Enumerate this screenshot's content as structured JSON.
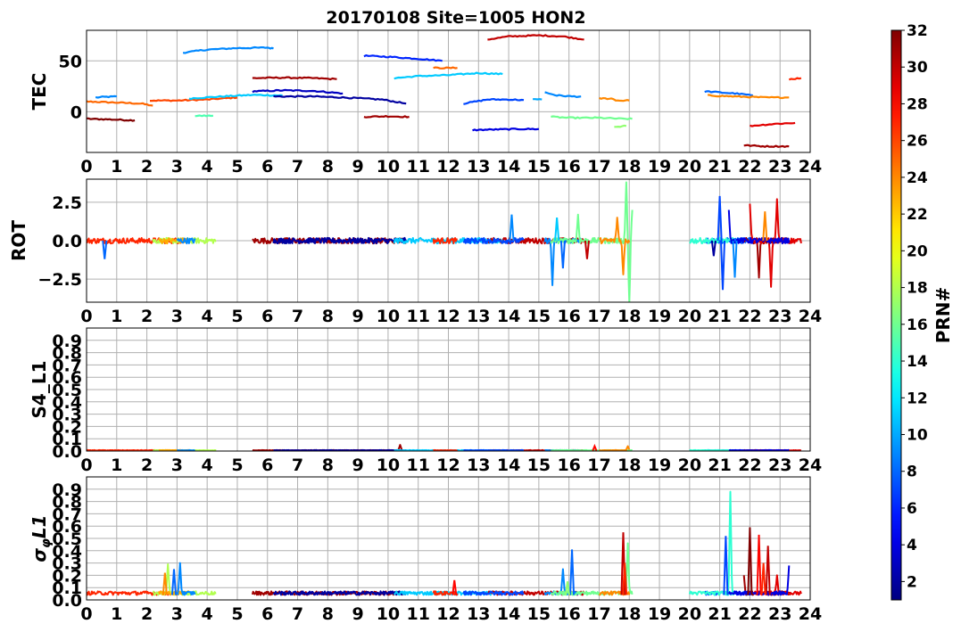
{
  "chart_data": {
    "type": "line",
    "title": "20170108 Site=1005 HON2",
    "x_ticks": [
      "0",
      "1",
      "2",
      "3",
      "4",
      "5",
      "6",
      "7",
      "8",
      "9",
      "10",
      "11",
      "12",
      "13",
      "14",
      "15",
      "16",
      "17",
      "18",
      "19",
      "20",
      "21",
      "22",
      "23",
      "24"
    ],
    "xlim": [
      0,
      24
    ],
    "grid": true,
    "colorbar": {
      "label": "PRN#",
      "range": [
        1,
        32
      ],
      "ticks": [
        "2",
        "4",
        "6",
        "8",
        "10",
        "12",
        "14",
        "16",
        "18",
        "20",
        "22",
        "24",
        "26",
        "28",
        "30",
        "32"
      ],
      "colormap": "jet"
    },
    "panels": [
      {
        "ylabel": "TEC",
        "ylim": [
          -40,
          80
        ],
        "y_ticks": [
          {
            "v": 50,
            "label": "50"
          },
          {
            "v": 0,
            "label": "0"
          }
        ],
        "series": [
          {
            "prn": 9,
            "points": [
              [
                0.3,
                14
              ],
              [
                0.6,
                14.5
              ],
              [
                1.0,
                15
              ]
            ]
          },
          {
            "prn": 25,
            "points": [
              [
                0,
                10
              ],
              [
                1,
                9
              ],
              [
                1.8,
                8
              ],
              [
                2.2,
                6
              ]
            ]
          },
          {
            "prn": 32,
            "points": [
              [
                0,
                -7
              ],
              [
                0.7,
                -7.5
              ],
              [
                1.6,
                -8.5
              ]
            ]
          },
          {
            "prn": 26,
            "points": [
              [
                2.1,
                11
              ],
              [
                3,
                11
              ],
              [
                4,
                12
              ],
              [
                5,
                14
              ]
            ]
          },
          {
            "prn": 15,
            "points": [
              [
                3.6,
                -4
              ],
              [
                4.2,
                -4
              ]
            ]
          },
          {
            "prn": 9,
            "points": [
              [
                3.2,
                58
              ],
              [
                4,
                61
              ],
              [
                5,
                62.5
              ],
              [
                6,
                63
              ],
              [
                6.2,
                62
              ]
            ]
          },
          {
            "prn": 11,
            "points": [
              [
                3.4,
                13
              ],
              [
                4.5,
                15
              ],
              [
                5.5,
                16.5
              ],
              [
                6.5,
                16
              ]
            ]
          },
          {
            "prn": 31,
            "points": [
              [
                5.5,
                33
              ],
              [
                6.5,
                33.5
              ],
              [
                7.5,
                33
              ],
              [
                8.3,
                32
              ]
            ]
          },
          {
            "prn": 3,
            "points": [
              [
                5.5,
                20
              ],
              [
                6.5,
                21
              ],
              [
                7.5,
                20.5
              ],
              [
                8.5,
                18
              ]
            ]
          },
          {
            "prn": 2,
            "points": [
              [
                6.2,
                15
              ],
              [
                7.5,
                15
              ],
              [
                8.5,
                14
              ],
              [
                9.8,
                12
              ],
              [
                10.6,
                8
              ]
            ]
          },
          {
            "prn": 6,
            "points": [
              [
                9.2,
                55
              ],
              [
                10,
                54
              ],
              [
                11,
                52
              ],
              [
                11.8,
                50
              ]
            ]
          },
          {
            "prn": 31,
            "points": [
              [
                9.2,
                -5
              ],
              [
                10,
                -4.5
              ],
              [
                10.7,
                -5
              ]
            ]
          },
          {
            "prn": 25,
            "points": [
              [
                11.5,
                43
              ],
              [
                12.3,
                43
              ]
            ]
          },
          {
            "prn": 11,
            "points": [
              [
                10.2,
                33
              ],
              [
                11,
                35
              ],
              [
                12,
                36
              ],
              [
                13,
                38
              ],
              [
                13.8,
                37
              ]
            ]
          },
          {
            "prn": 30,
            "points": [
              [
                13.3,
                71
              ],
              [
                14,
                74
              ],
              [
                15,
                75
              ],
              [
                15.8,
                74
              ],
              [
                16.5,
                71
              ]
            ]
          },
          {
            "prn": 7,
            "points": [
              [
                12.5,
                8
              ],
              [
                13.3,
                12
              ],
              [
                14,
                12
              ],
              [
                14.5,
                11.5
              ]
            ]
          },
          {
            "prn": 10,
            "points": [
              [
                14.8,
                12
              ],
              [
                15.1,
                12
              ]
            ]
          },
          {
            "prn": 4,
            "points": [
              [
                12.8,
                -18
              ],
              [
                13.5,
                -17.5
              ],
              [
                14.3,
                -17
              ],
              [
                15,
                -17
              ]
            ]
          },
          {
            "prn": 9,
            "points": [
              [
                15.2,
                19
              ],
              [
                15.6,
                16
              ],
              [
                16.1,
                15
              ],
              [
                16.4,
                15
              ]
            ]
          },
          {
            "prn": 16,
            "points": [
              [
                15.4,
                -5
              ],
              [
                16,
                -6
              ],
              [
                17,
                -6
              ],
              [
                17.8,
                -7
              ],
              [
                18.1,
                -7
              ]
            ]
          },
          {
            "prn": 17,
            "points": [
              [
                17.5,
                -15
              ],
              [
                17.9,
                -14
              ]
            ]
          },
          {
            "prn": 24,
            "points": [
              [
                17,
                13
              ],
              [
                17.4,
                13
              ],
              [
                17.6,
                11
              ],
              [
                18,
                11
              ]
            ]
          },
          {
            "prn": 8,
            "points": [
              [
                20.5,
                20
              ],
              [
                21,
                19
              ],
              [
                21.5,
                18
              ],
              [
                22.1,
                16
              ]
            ]
          },
          {
            "prn": 24,
            "points": [
              [
                20.6,
                16
              ],
              [
                21.5,
                15
              ],
              [
                22.5,
                14
              ],
              [
                23.3,
                14
              ]
            ]
          },
          {
            "prn": 27,
            "points": [
              [
                23.3,
                32
              ],
              [
                23.7,
                33
              ]
            ]
          },
          {
            "prn": 29,
            "points": [
              [
                22,
                -14
              ],
              [
                22.8,
                -12
              ],
              [
                23.5,
                -11
              ]
            ]
          },
          {
            "prn": 31,
            "points": [
              [
                21.8,
                -33
              ],
              [
                22.5,
                -34
              ],
              [
                23.3,
                -34
              ]
            ]
          }
        ]
      },
      {
        "ylabel": "ROT",
        "ylim": [
          -4,
          4
        ],
        "y_ticks": [
          {
            "v": 2.5,
            "label": "2.5"
          },
          {
            "v": 0,
            "label": "0.0"
          },
          {
            "v": -2.5,
            "label": "−2.5"
          }
        ]
      },
      {
        "ylabel": "S4_L1",
        "ylim": [
          0,
          1
        ],
        "y_ticks": [
          {
            "v": 0,
            "label": "0.0"
          },
          {
            "v": 0.1,
            "label": "0.1"
          },
          {
            "v": 0.2,
            "label": "0.2"
          },
          {
            "v": 0.3,
            "label": "0.3"
          },
          {
            "v": 0.4,
            "label": "0.4"
          },
          {
            "v": 0.5,
            "label": "0.5"
          },
          {
            "v": 0.6,
            "label": "0.6"
          },
          {
            "v": 0.7,
            "label": "0.7"
          },
          {
            "v": 0.8,
            "label": "0.8"
          },
          {
            "v": 0.9,
            "label": "0.9"
          }
        ]
      },
      {
        "ylabel": "σφL1",
        "ylabel_base": "σ",
        "ylabel_sub": "φ",
        "ylabel_rest": "L1",
        "ylim": [
          0,
          1
        ],
        "y_ticks": [
          {
            "v": 0,
            "label": "0.0"
          },
          {
            "v": 0.1,
            "label": "0.1"
          },
          {
            "v": 0.2,
            "label": "0.2"
          },
          {
            "v": 0.3,
            "label": "0.3"
          },
          {
            "v": 0.4,
            "label": "0.4"
          },
          {
            "v": 0.5,
            "label": "0.5"
          },
          {
            "v": 0.6,
            "label": "0.6"
          },
          {
            "v": 0.7,
            "label": "0.7"
          },
          {
            "v": 0.8,
            "label": "0.8"
          },
          {
            "v": 0.9,
            "label": "0.9"
          }
        ]
      }
    ],
    "activity_intervals": [
      {
        "prn": 27,
        "x": [
          0,
          3.2
        ]
      },
      {
        "prn": 18,
        "x": [
          2.2,
          4.3
        ]
      },
      {
        "prn": 23,
        "x": [
          2.4,
          3.4
        ]
      },
      {
        "prn": 9,
        "x": [
          3.0,
          3.6
        ]
      },
      {
        "prn": 31,
        "x": [
          5.5,
          10.6
        ]
      },
      {
        "prn": 2,
        "x": [
          6.2,
          10.6
        ]
      },
      {
        "prn": 11,
        "x": [
          10.2,
          13.8
        ]
      },
      {
        "prn": 27,
        "x": [
          11.5,
          12.3
        ]
      },
      {
        "prn": 30,
        "x": [
          13.3,
          16.5
        ]
      },
      {
        "prn": 7,
        "x": [
          12.5,
          14.5
        ]
      },
      {
        "prn": 9,
        "x": [
          15.2,
          16.4
        ]
      },
      {
        "prn": 16,
        "x": [
          15.4,
          18.1
        ]
      },
      {
        "prn": 24,
        "x": [
          17.0,
          18.0
        ]
      },
      {
        "prn": 8,
        "x": [
          20.5,
          22.1
        ]
      },
      {
        "prn": 14,
        "x": [
          20.0,
          21.5
        ]
      },
      {
        "prn": 31,
        "x": [
          21.8,
          23.3
        ]
      },
      {
        "prn": 29,
        "x": [
          22.0,
          23.7
        ]
      },
      {
        "prn": 4,
        "x": [
          21.3,
          23.3
        ]
      }
    ],
    "spikes": {
      "rot": [
        {
          "prn": 8,
          "x": 0.6,
          "v": -1.2
        },
        {
          "prn": 9,
          "x": 14.1,
          "v": 1.7
        },
        {
          "prn": 9,
          "x": 15.45,
          "v": -2.9
        },
        {
          "prn": 11,
          "x": 15.6,
          "v": 1.5
        },
        {
          "prn": 8,
          "x": 15.8,
          "v": -1.8
        },
        {
          "prn": 16,
          "x": 16.3,
          "v": 1.7
        },
        {
          "prn": 30,
          "x": 16.6,
          "v": -1.2
        },
        {
          "prn": 24,
          "x": 17.6,
          "v": 1.5
        },
        {
          "prn": 16,
          "x": 17.9,
          "v": 3.8
        },
        {
          "prn": 16,
          "x": 18.0,
          "v": -4.0
        },
        {
          "prn": 24,
          "x": 17.8,
          "v": -2.2
        },
        {
          "prn": 16,
          "x": 18.1,
          "v": 2.0
        },
        {
          "prn": 7,
          "x": 21.0,
          "v": 2.9
        },
        {
          "prn": 7,
          "x": 21.1,
          "v": -3.2
        },
        {
          "prn": 4,
          "x": 21.3,
          "v": 2.0
        },
        {
          "prn": 9,
          "x": 21.5,
          "v": -2.4
        },
        {
          "prn": 29,
          "x": 22.0,
          "v": 2.4
        },
        {
          "prn": 31,
          "x": 22.3,
          "v": -2.4
        },
        {
          "prn": 24,
          "x": 22.5,
          "v": 1.9
        },
        {
          "prn": 29,
          "x": 22.7,
          "v": -3.0
        },
        {
          "prn": 29,
          "x": 22.9,
          "v": 2.7
        },
        {
          "prn": 2,
          "x": 20.8,
          "v": -1.0
        }
      ],
      "s4": [
        {
          "prn": 31,
          "x": 10.4,
          "v": 0.05
        },
        {
          "prn": 28,
          "x": 16.85,
          "v": 0.04
        },
        {
          "prn": 24,
          "x": 17.95,
          "v": 0.04
        }
      ],
      "sigma": [
        {
          "prn": 18,
          "x": 2.7,
          "v": 0.29
        },
        {
          "prn": 24,
          "x": 2.6,
          "v": 0.22
        },
        {
          "prn": 9,
          "x": 3.1,
          "v": 0.3
        },
        {
          "prn": 8,
          "x": 2.9,
          "v": 0.25
        },
        {
          "prn": 28,
          "x": 12.2,
          "v": 0.16
        },
        {
          "prn": 9,
          "x": 15.8,
          "v": 0.25
        },
        {
          "prn": 8,
          "x": 16.1,
          "v": 0.41
        },
        {
          "prn": 17,
          "x": 15.95,
          "v": 0.15
        },
        {
          "prn": 30,
          "x": 17.8,
          "v": 0.55
        },
        {
          "prn": 27,
          "x": 17.85,
          "v": 0.3
        },
        {
          "prn": 16,
          "x": 17.95,
          "v": 0.46
        },
        {
          "prn": 14,
          "x": 21.35,
          "v": 0.88
        },
        {
          "prn": 7,
          "x": 21.2,
          "v": 0.52
        },
        {
          "prn": 32,
          "x": 22.0,
          "v": 0.59
        },
        {
          "prn": 28,
          "x": 22.3,
          "v": 0.53
        },
        {
          "prn": 30,
          "x": 22.6,
          "v": 0.44
        },
        {
          "prn": 4,
          "x": 23.3,
          "v": 0.28
        },
        {
          "prn": 27,
          "x": 22.45,
          "v": 0.3
        },
        {
          "prn": 31,
          "x": 21.8,
          "v": 0.2
        },
        {
          "prn": 29,
          "x": 22.9,
          "v": 0.2
        }
      ]
    }
  }
}
